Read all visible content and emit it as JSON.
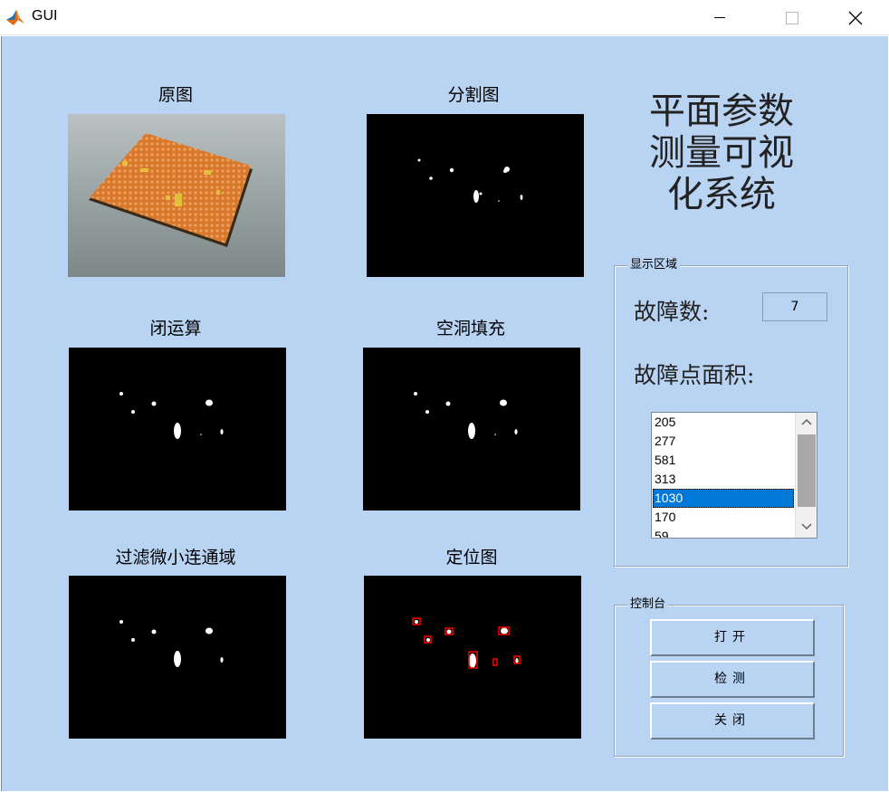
{
  "window": {
    "title": "GUI",
    "icon": "matlab-icon",
    "controls": [
      "minimize-icon",
      "maximize-icon",
      "close-icon"
    ]
  },
  "panels": {
    "original": "原图",
    "segmentation": "分割图",
    "closing": "闭运算",
    "hole_fill": "空洞填充",
    "filter_small": "过滤微小连通域",
    "localization": "定位图"
  },
  "main_title": [
    "平面参数",
    "测量可视",
    "化系统"
  ],
  "display_area": {
    "label": "显示区域",
    "fault_count_label": "故障数:",
    "fault_count_value": "7",
    "fault_area_label": "故障点面积:",
    "areas": [
      "205",
      "277",
      "581",
      "313",
      "1030",
      "170",
      "59"
    ],
    "selected_value": "1030"
  },
  "console": {
    "label": "控制台",
    "open_label": "打开",
    "detect_label": "检测",
    "close_label": "关闭"
  },
  "colors": {
    "figure_bg": "#b9d3f3",
    "listbox_selection": "#0078d7",
    "bbox": "#ff0000"
  }
}
